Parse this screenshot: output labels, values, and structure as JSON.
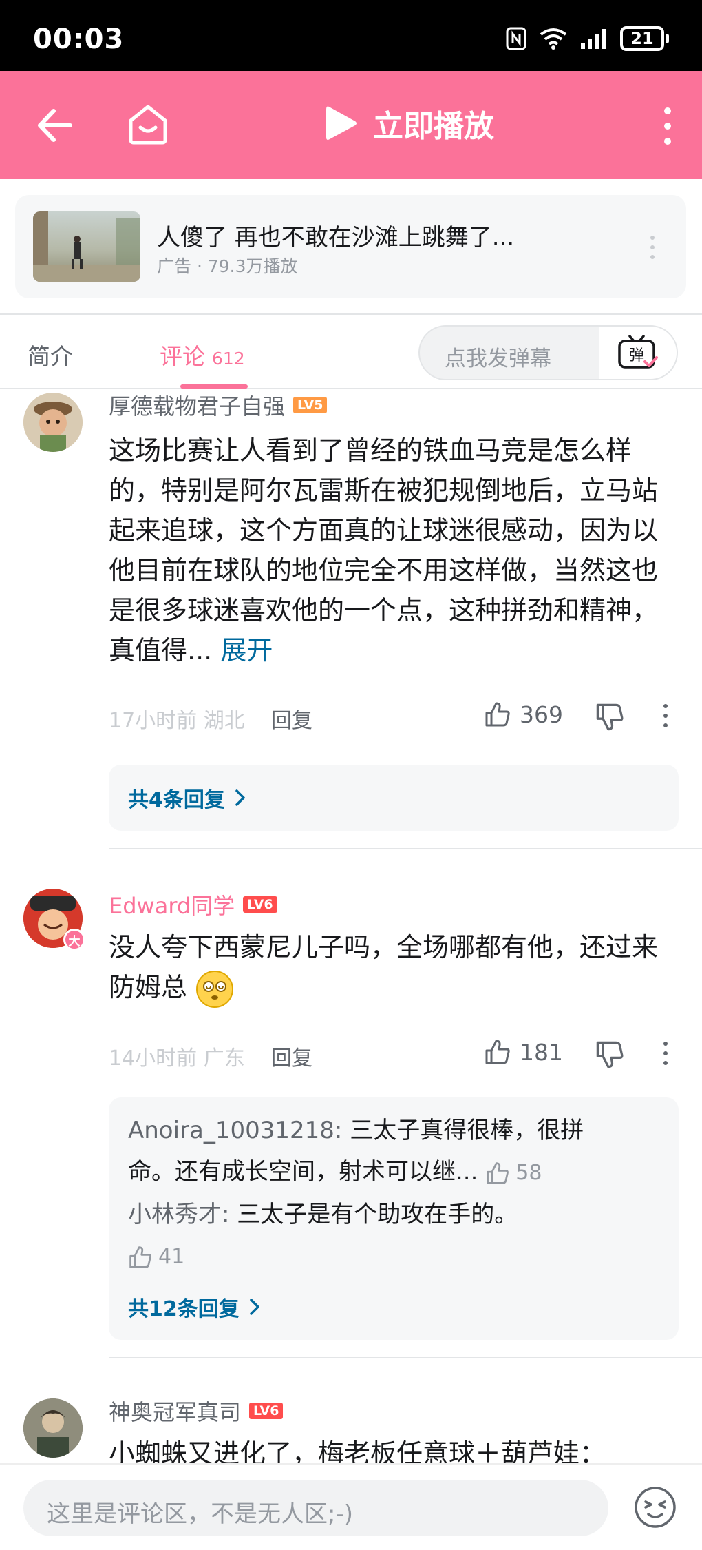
{
  "status_bar": {
    "time": "00:03",
    "battery": "21"
  },
  "header": {
    "play_label": "立即播放"
  },
  "ad": {
    "title": "人傻了 再也不敢在沙滩上跳舞了...",
    "meta": "广告 · 79.3万播放"
  },
  "tabs": {
    "intro": "简介",
    "comments": "评论",
    "comments_count": "612",
    "danmaku_placeholder": "点我发弹幕",
    "danmaku_icon_text": "弹"
  },
  "comments": [
    {
      "username": "厚德载物君子自强",
      "level": "LV5",
      "text": "这场比赛让人看到了曾经的铁血马竞是怎么样的，特别是阿尔瓦雷斯在被犯规倒地后，立马站起来追球，这个方面真的让球迷很感动，因为以他目前在球队的地位完全不用这样做，当然这也是很多球迷喜欢他的一个点，这种拼劲和精神，真值得...",
      "expand": "展开",
      "time": "17小时前 湖北",
      "reply": "回复",
      "likes": "369",
      "replies_link": "共4条回复"
    },
    {
      "username": "Edward同学",
      "level": "LV6",
      "badge": "大",
      "text": "没人夸下西蒙尼儿子吗，全场哪都有他，还过来防姆总",
      "time": "14小时前 广东",
      "reply": "回复",
      "likes": "181",
      "sub_replies": [
        {
          "user": "Anoira_10031218:",
          "text": " 三太子真得很棒，很拼命。还有成长空间，射术可以继...",
          "likes": "58"
        },
        {
          "user": "小林秀才:",
          "text": " 三太子是有个助攻在手的。",
          "likes": "41"
        }
      ],
      "replies_link": "共12条回复"
    },
    {
      "username": "神奥冠军真司",
      "level": "LV6",
      "text": "小蜘蛛又进化了，梅老板任意球＋葫芦娃："
    }
  ],
  "bottom": {
    "input_placeholder": "这里是评论区，不是无人区;-)"
  },
  "colors": {
    "brand_pink": "#fb7299",
    "link_blue": "#00699d",
    "muted": "#9499a0"
  }
}
